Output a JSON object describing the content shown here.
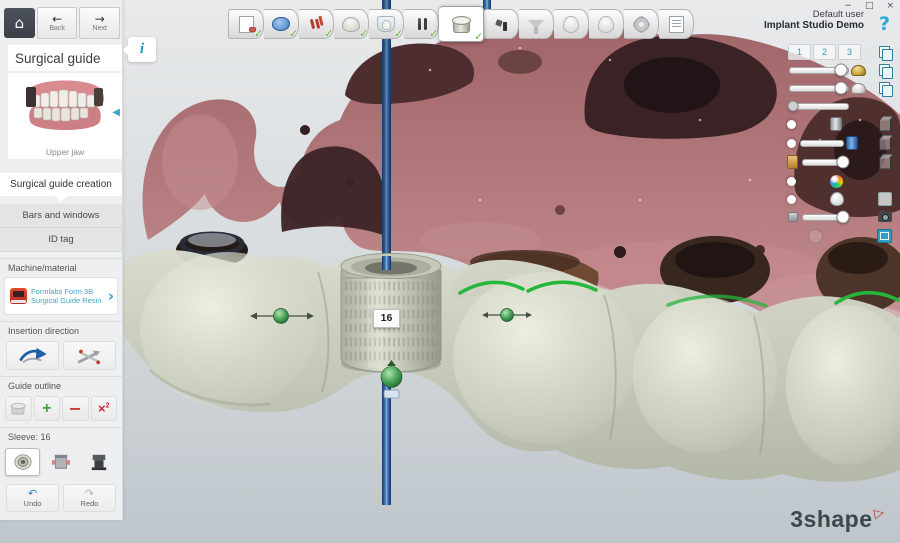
{
  "window": {
    "minimize_glyph": "−",
    "maximize_glyph": "□",
    "close_glyph": "×"
  },
  "header": {
    "home_glyph": "⌂",
    "back_arrow": "←",
    "back_label": "Back",
    "next_arrow": "→",
    "next_label": "Next",
    "user_name": "Default user",
    "project_name": "Implant Studio Demo",
    "help_glyph": "?"
  },
  "workflow": {
    "check_glyph": "✓",
    "steps": [
      {
        "icon": "scan-import",
        "completed": true,
        "active": false
      },
      {
        "icon": "scan-alignment",
        "completed": true,
        "active": false
      },
      {
        "icon": "implant-planning",
        "completed": true,
        "active": false
      },
      {
        "icon": "crown-design",
        "completed": true,
        "active": false
      },
      {
        "icon": "guide-with-teeth",
        "completed": true,
        "active": false
      },
      {
        "icon": "abutments",
        "completed": true,
        "active": false
      },
      {
        "icon": "sleeves",
        "completed": true,
        "active": true
      },
      {
        "icon": "id-tag",
        "completed": false,
        "active": false
      },
      {
        "icon": "guide-outline-funnel",
        "completed": false,
        "active": false
      },
      {
        "icon": "tooth-outline-a",
        "completed": false,
        "active": false
      },
      {
        "icon": "tooth-outline-b",
        "completed": false,
        "active": false
      },
      {
        "icon": "settings-gear",
        "completed": false,
        "active": false
      },
      {
        "icon": "report-export",
        "completed": false,
        "active": false
      }
    ]
  },
  "sidebar": {
    "title": "Surgical guide",
    "info_glyph": "i",
    "thumb_arrow": "◀",
    "jaw_caption": "Upper jaw",
    "tabs": [
      {
        "label": "Surgical guide creation",
        "active": true
      },
      {
        "label": "Bars and windows",
        "active": false
      },
      {
        "label": "ID tag",
        "active": false
      }
    ],
    "machine": {
      "section": "Machine/material",
      "printer": "Formlabs Form 3B",
      "material": "Surgical Guide Resin",
      "chevron": "›"
    },
    "insertion": {
      "section": "Insertion direction"
    },
    "outline": {
      "section": "Guide outline",
      "add_glyph": "+",
      "remove_glyph": "−",
      "clear_glyph": "×",
      "clear_sup": "2"
    },
    "sleeve": {
      "section": "Sleeve: 16"
    },
    "undo_glyph": "↶",
    "undo_label": "Undo",
    "redo_glyph": "↷",
    "redo_label": "Redo"
  },
  "right_panel": {
    "view_tabs": [
      "1",
      "2",
      "3"
    ]
  },
  "viewport": {
    "sleeve_label": "16"
  },
  "logo": {
    "text": "3shape",
    "mark": "▷"
  }
}
